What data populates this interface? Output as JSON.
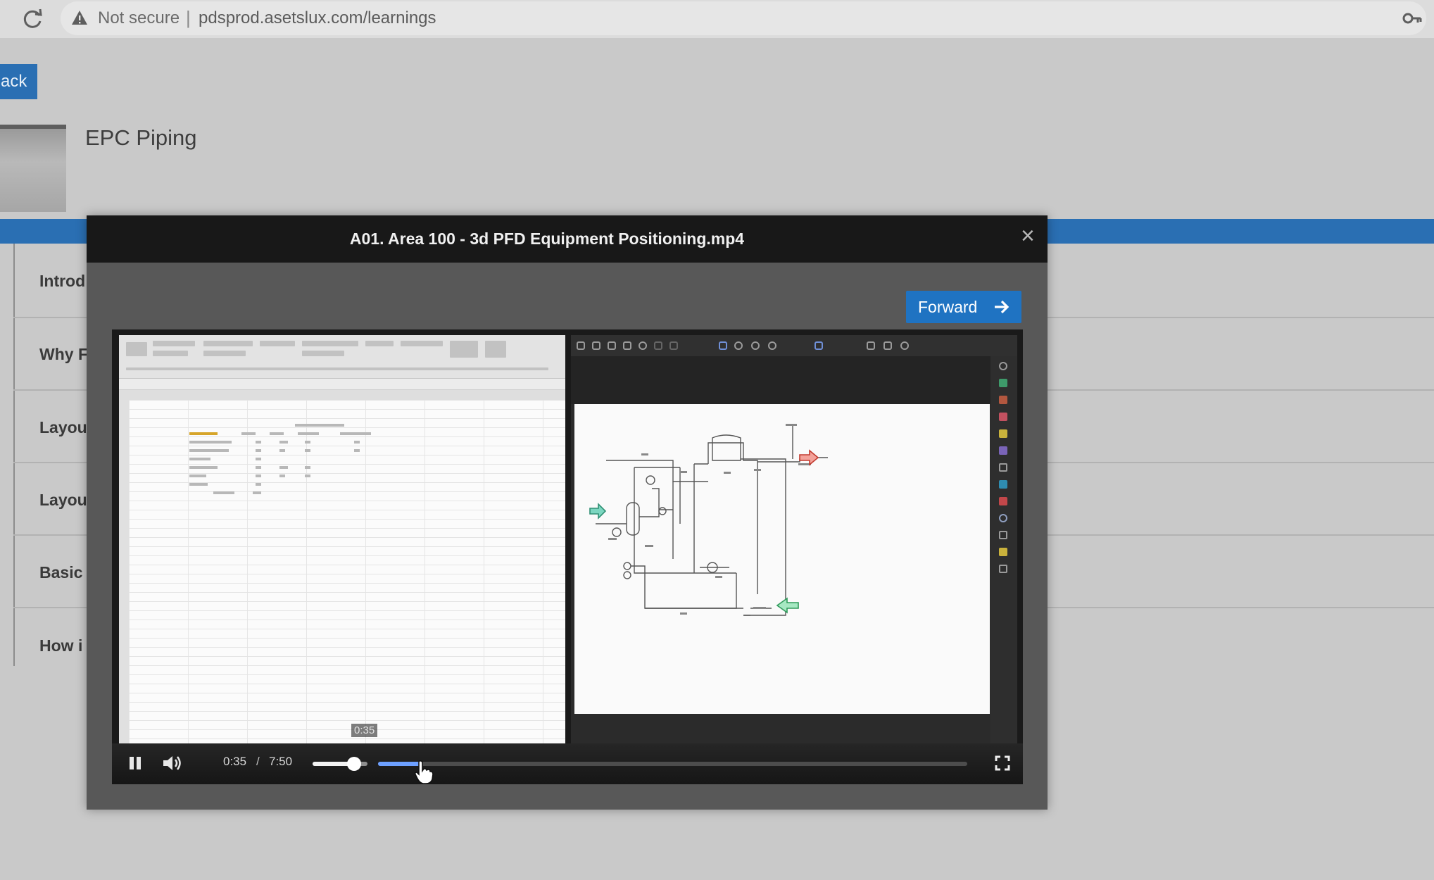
{
  "browser": {
    "security_label": "Not secure",
    "separator": "|",
    "url": "pdsprod.asetslux.com/learnings"
  },
  "page": {
    "back_label": "ack",
    "course_title": "EPC Piping",
    "menu_items": [
      "Introd",
      "Why F",
      "Layou",
      "Layou",
      "Basic",
      "How i"
    ]
  },
  "modal": {
    "title": "A01. Area 100 - 3d PFD Equipment Positioning.mp4",
    "close_glyph": "×",
    "forward_label": "Forward"
  },
  "player": {
    "state": "playing",
    "current_time": "0:35",
    "separator": "/",
    "total_time": "7:50",
    "seek_tooltip": "0:35",
    "volume_level": 0.75,
    "progress_fraction": 0.074
  },
  "icons": {
    "reload": "reload-icon",
    "warning": "warning-icon",
    "key": "key-icon",
    "close": "close-icon",
    "forward": "arrow-right-icon",
    "pause": "pause-icon",
    "volume": "volume-icon",
    "fullscreen": "fullscreen-icon",
    "cursor": "hand-cursor-icon"
  },
  "colors": {
    "accent_blue": "#2a6fb3",
    "forward_button": "#1f73c2",
    "modal_header": "#181818",
    "seek_played": "#6da0ff"
  }
}
